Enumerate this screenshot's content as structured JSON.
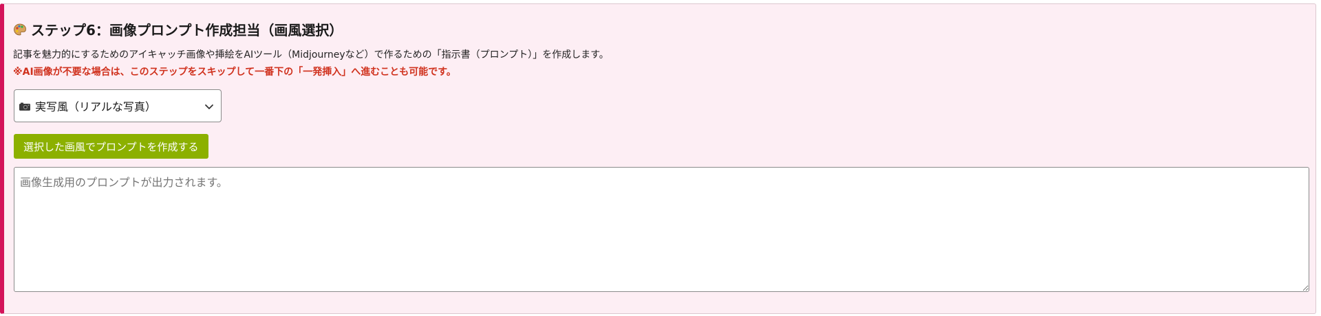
{
  "section": {
    "title": "ステップ6：画像プロンプト作成担当（画風選択）",
    "title_icon": "palette-icon",
    "description": "記事を魅力的にするためのアイキャッチ画像や挿絵をAIツール（Midjourneyなど）で作るための「指示書（プロンプト）」を作成します。",
    "note": "※AI画像が不要な場合は、このステップをスキップして一番下の「一発挿入」へ進むことも可能です。",
    "note_color": "#d0321e",
    "accent_color": "#d4145a",
    "background_color": "#fdeef4"
  },
  "style_select": {
    "selected_icon": "camera-icon",
    "selected_label": "実写風（リアルな写真）"
  },
  "generate_button": {
    "label": "選択した画風でプロンプトを作成する",
    "color": "#8cb000"
  },
  "output": {
    "placeholder": "画像生成用のプロンプトが出力されます。"
  }
}
